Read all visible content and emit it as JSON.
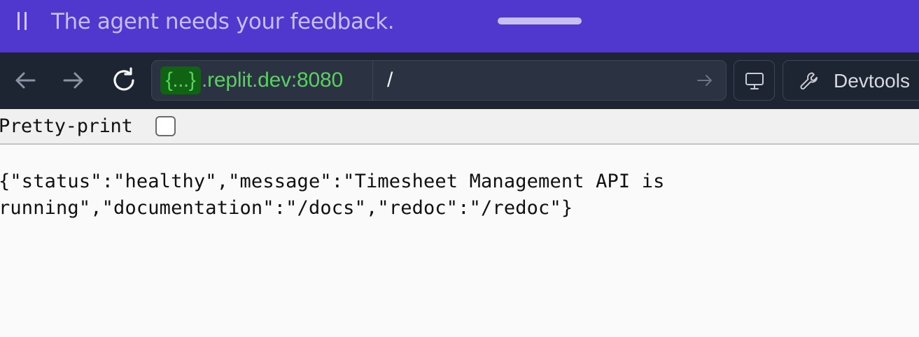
{
  "banner": {
    "message": "The agent needs your feedback."
  },
  "toolbar": {
    "url": {
      "subdomain_pill": "{...}",
      "host": ".replit.dev:8080",
      "path": "/"
    },
    "devtools_label": "Devtools"
  },
  "viewer": {
    "pretty_print_label": "Pretty-print",
    "pretty_print_checked": false,
    "json_line_1": "{\"status\":\"healthy\",\"message\":\"Timesheet Management API is",
    "json_line_2": "running\",\"documentation\":\"/docs\",\"redoc\":\"/redoc\"}"
  },
  "colors": {
    "banner_bg": "#5038cf",
    "toolbar_bg": "#1d2432",
    "url_host_green": "#59d160",
    "url_pill_bg": "#0f6313",
    "page_bg": "#fafafa"
  }
}
